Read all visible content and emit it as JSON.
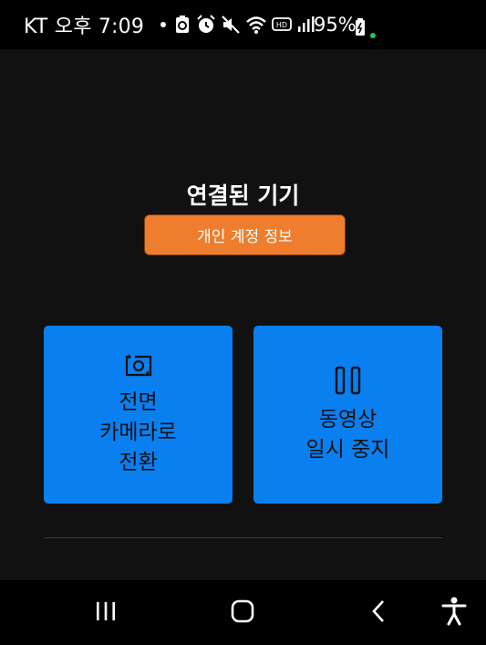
{
  "status_bar": {
    "carrier_time": "KT 오후 7:09",
    "battery": "95%",
    "icons": [
      "recycle-icon",
      "alarm-icon",
      "mute-icon",
      "wifi-icon",
      "hd-icon",
      "signal-icon",
      "battery-icon"
    ]
  },
  "device": {
    "title": "연결된 기기",
    "account_button": "개인 계정 정보",
    "account_color": "#ee7e2d"
  },
  "tiles": [
    {
      "label": "전면\n카메라로\n전환",
      "icon": "switch-camera-icon"
    },
    {
      "label": "동영상\n일시 중지",
      "icon": "pause-icon"
    }
  ],
  "nav_bar": {
    "icons": [
      "recents-icon",
      "home-icon",
      "back-icon",
      "accessibility-icon"
    ]
  },
  "colors": {
    "tile_blue": "#0a7ff0",
    "background": "#111111"
  }
}
